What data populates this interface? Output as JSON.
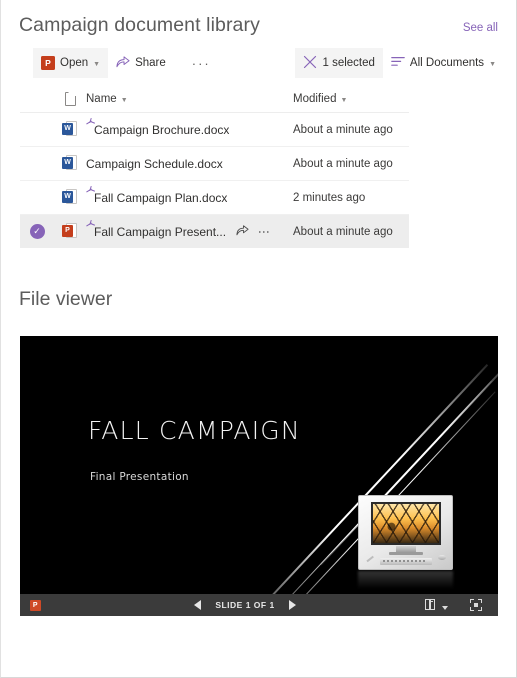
{
  "library": {
    "title": "Campaign document library",
    "see_all_label": "See all",
    "toolbar": {
      "open_label": "Open",
      "open_icon": "powerpoint-icon",
      "share_label": "Share",
      "share_icon": "share-icon",
      "more_label": "···",
      "selection_label": "1 selected",
      "selection_icon": "close-icon",
      "view_label": "All Documents",
      "view_icon": "list-view-icon",
      "chevron": "⌄"
    },
    "columns": {
      "file_type": "file-type-icon",
      "name": "Name",
      "modified": "Modified"
    },
    "rows": [
      {
        "name": "Campaign Brochure.docx",
        "modified": "About a minute ago",
        "type": "word",
        "badge": "W",
        "is_new": true,
        "selected": false
      },
      {
        "name": "Campaign Schedule.docx",
        "modified": "About a minute ago",
        "type": "word",
        "badge": "W",
        "is_new": false,
        "selected": false
      },
      {
        "name": "Fall Campaign Plan.docx",
        "modified": "2 minutes ago",
        "type": "word",
        "badge": "W",
        "is_new": true,
        "selected": false
      },
      {
        "name": "Fall Campaign Present...",
        "modified": "About a minute ago",
        "type": "powerpoint",
        "badge": "P",
        "is_new": true,
        "selected": true
      }
    ]
  },
  "file_viewer": {
    "title": "File viewer",
    "slide": {
      "title": "FALL CAMPAIGN",
      "subtitle": "Final Presentation",
      "image_alt": "desktop-computer-photo"
    },
    "chrome": {
      "app_icon": "powerpoint-icon",
      "app_badge": "P",
      "prev_label": "previous-slide",
      "next_label": "next-slide",
      "slide_counter": "SLIDE 1 OF 1",
      "notes_icon": "notes-view-icon",
      "fullscreen_icon": "fullscreen-icon"
    }
  },
  "colors": {
    "accent_purple": "#8764b8",
    "word_blue": "#2b579a",
    "powerpoint_orange": "#c43e1c",
    "selected_row": "#ededed",
    "slide_bg": "#000000",
    "slide_chrome": "#3b3b3b"
  }
}
